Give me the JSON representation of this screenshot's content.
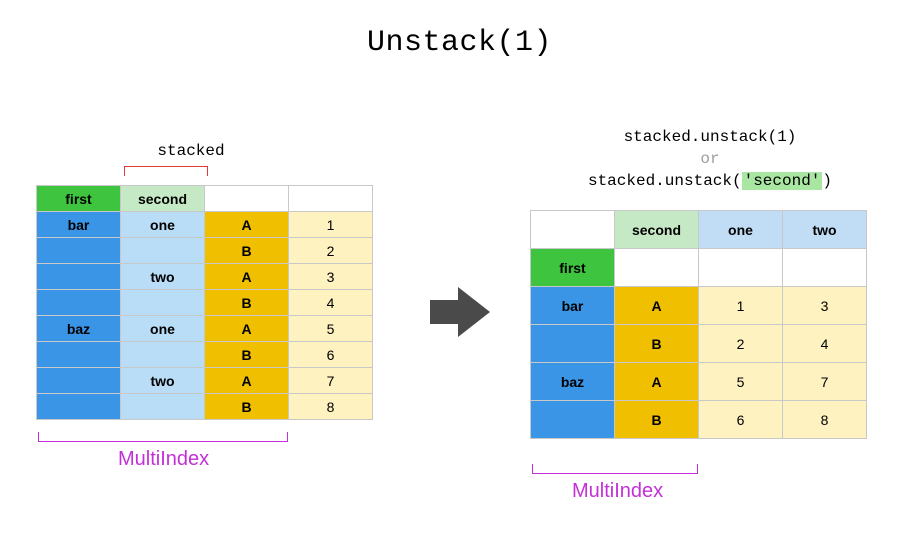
{
  "title": "Unstack(1)",
  "stacked_label": "stacked",
  "code": {
    "line1": "stacked.unstack(1)",
    "or": "or",
    "line2_pre": "stacked.unstack(",
    "line2_hl": "'second'",
    "line2_post": ")"
  },
  "left": {
    "hdr_first": "first",
    "hdr_second": "second",
    "rows": [
      {
        "first": "bar",
        "second": "one",
        "c": "A",
        "v": "1"
      },
      {
        "first": "",
        "second": "",
        "c": "B",
        "v": "2"
      },
      {
        "first": "",
        "second": "two",
        "c": "A",
        "v": "3"
      },
      {
        "first": "",
        "second": "",
        "c": "B",
        "v": "4"
      },
      {
        "first": "baz",
        "second": "one",
        "c": "A",
        "v": "5"
      },
      {
        "first": "",
        "second": "",
        "c": "B",
        "v": "6"
      },
      {
        "first": "",
        "second": "two",
        "c": "A",
        "v": "7"
      },
      {
        "first": "",
        "second": "",
        "c": "B",
        "v": "8"
      }
    ]
  },
  "right": {
    "hdr_second": "second",
    "cols": [
      "one",
      "two"
    ],
    "hdr_first": "first",
    "rows": [
      {
        "first": "bar",
        "c": "A",
        "one": "1",
        "two": "3"
      },
      {
        "first": "",
        "c": "B",
        "one": "2",
        "two": "4"
      },
      {
        "first": "baz",
        "c": "A",
        "one": "5",
        "two": "7"
      },
      {
        "first": "",
        "c": "B",
        "one": "6",
        "two": "8"
      }
    ]
  },
  "multiindex_label": "MultiIndex"
}
